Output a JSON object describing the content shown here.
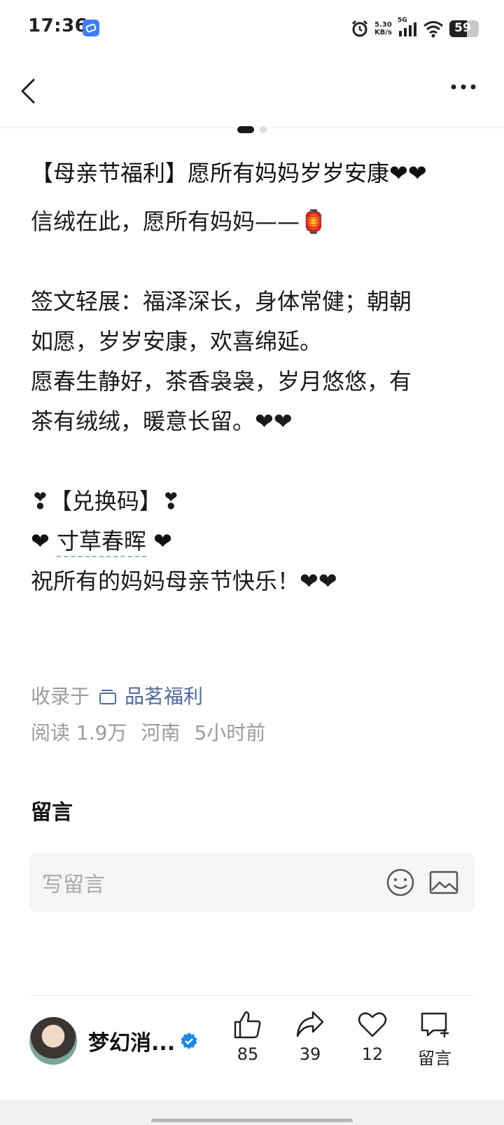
{
  "status_bar": {
    "time": "17:36",
    "net_speed_value": "5.30",
    "net_speed_unit": "KB/s",
    "network": "5G",
    "battery": "59",
    "battery_level": 0.59
  },
  "post": {
    "title": "【母亲节福利】愿所有妈妈岁岁安康❤❤",
    "lines": [
      "信绒在此，愿所有妈妈——🏮",
      "",
      "签文轻展：福泽深长，身体常健；朝朝",
      "如愿，岁岁安康，欢喜绵延。",
      "愿春生静好，茶香袅袅，岁月悠悠，有",
      "茶有绒绒，暖意长留。❤❤",
      "",
      "❣【兑换码】❣"
    ],
    "code_heart": "❤",
    "code_word": "寸草春晖",
    "closing_line": "祝所有的妈妈母亲节快乐！❤❤"
  },
  "meta": {
    "collected_label": "收录于",
    "collection_name": "品茗福利",
    "reads": "阅读 1.9万",
    "location": "河南",
    "time_ago": "5小时前"
  },
  "comments": {
    "title": "留言",
    "placeholder": "写留言"
  },
  "footer": {
    "author_name": "梦幻消...",
    "like_count": "85",
    "share_count": "39",
    "fav_count": "12",
    "comment_label": "留言"
  },
  "colors": {
    "accent_blue": "#4e6a9c",
    "verified_blue": "#1e88e5",
    "underline_green": "#7fcfa3"
  }
}
